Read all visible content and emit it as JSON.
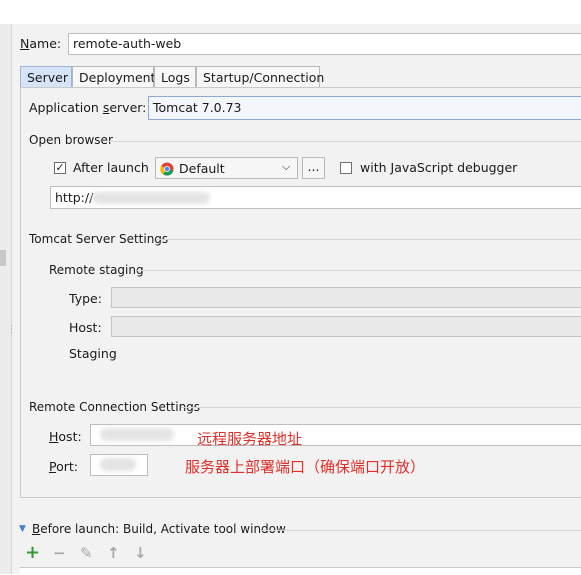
{
  "name": {
    "label": "Name:",
    "value": "remote-auth-web"
  },
  "tabs": [
    {
      "label": "Server",
      "active": true
    },
    {
      "label": "Deployment",
      "active": false
    },
    {
      "label": "Logs",
      "active": false
    },
    {
      "label": "Startup/Connection",
      "active": false
    }
  ],
  "server": {
    "app_server_label": "Application server:",
    "app_server_value": "Tomcat 7.0.73",
    "open_browser": {
      "title": "Open browser",
      "after_launch_label": "After launch",
      "after_launch_checked": true,
      "browser_value": "Default",
      "more_button": "...",
      "js_debugger_label": "with JavaScript debugger",
      "js_debugger_checked": false,
      "url_value": "http://"
    },
    "tomcat_settings": {
      "title": "Tomcat Server Settings",
      "remote_staging": {
        "title": "Remote staging",
        "type_label": "Type:",
        "host_label": "Host:",
        "staging_label": "Staging"
      }
    },
    "remote_connection": {
      "title": "Remote Connection Settings",
      "host_label": "Host:",
      "port_label": "Port:",
      "host_note": "远程服务器地址",
      "port_note": "服务器上部署端口（确保端口开放）"
    }
  },
  "before_launch": {
    "label": "Before launch: Build, Activate tool window",
    "tools": [
      "add-icon",
      "remove-icon",
      "edit-icon",
      "move-up-icon",
      "move-down-icon"
    ]
  },
  "colors": {
    "annotation": "#e0302a",
    "tab_active": "#d6e4f7",
    "add": "#3a9a3a"
  }
}
